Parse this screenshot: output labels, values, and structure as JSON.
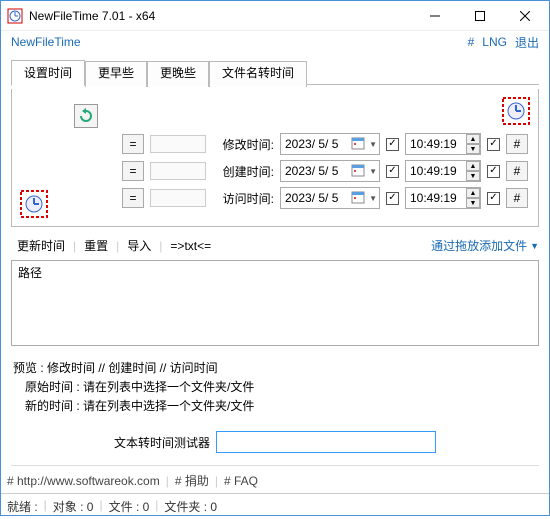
{
  "window": {
    "title": "NewFileTime 7.01 - x64"
  },
  "menubar": {
    "appname": "NewFileTime",
    "hash": "#",
    "lng": "LNG",
    "exit": "退出"
  },
  "tabs": {
    "t0": "设置时间",
    "t1": "更早些",
    "t2": "更晚些",
    "t3": "文件名转时间"
  },
  "rows": {
    "eq": "=",
    "modify_label": "修改时间:",
    "create_label": "创建时间:",
    "access_label": "访问时间:",
    "date": "2023/ 5/ 5",
    "time": "10:49:19",
    "hash": "#"
  },
  "toolbar2": {
    "update": "更新时间",
    "reset": "重置",
    "import": "导入",
    "txt": "=>txt<=",
    "drop": "通过拖放添加文件"
  },
  "list": {
    "header": "路径"
  },
  "preview": {
    "title": "预览 :   修改时间   //   创建时间   //   访问时间",
    "orig": "原始时间 : 请在列表中选择一个文件夹/文件",
    "new": "新的时间 : 请在列表中选择一个文件夹/文件"
  },
  "tester": {
    "label": "文本转时间测试器"
  },
  "footer": {
    "url_label": "# http://www.softwareok.com",
    "donate": "# 捐助",
    "faq": "# FAQ"
  },
  "status": {
    "ready": "就绪 :",
    "objects": "对象 : 0",
    "files": "文件 : 0",
    "folders": "文件夹 : 0"
  }
}
